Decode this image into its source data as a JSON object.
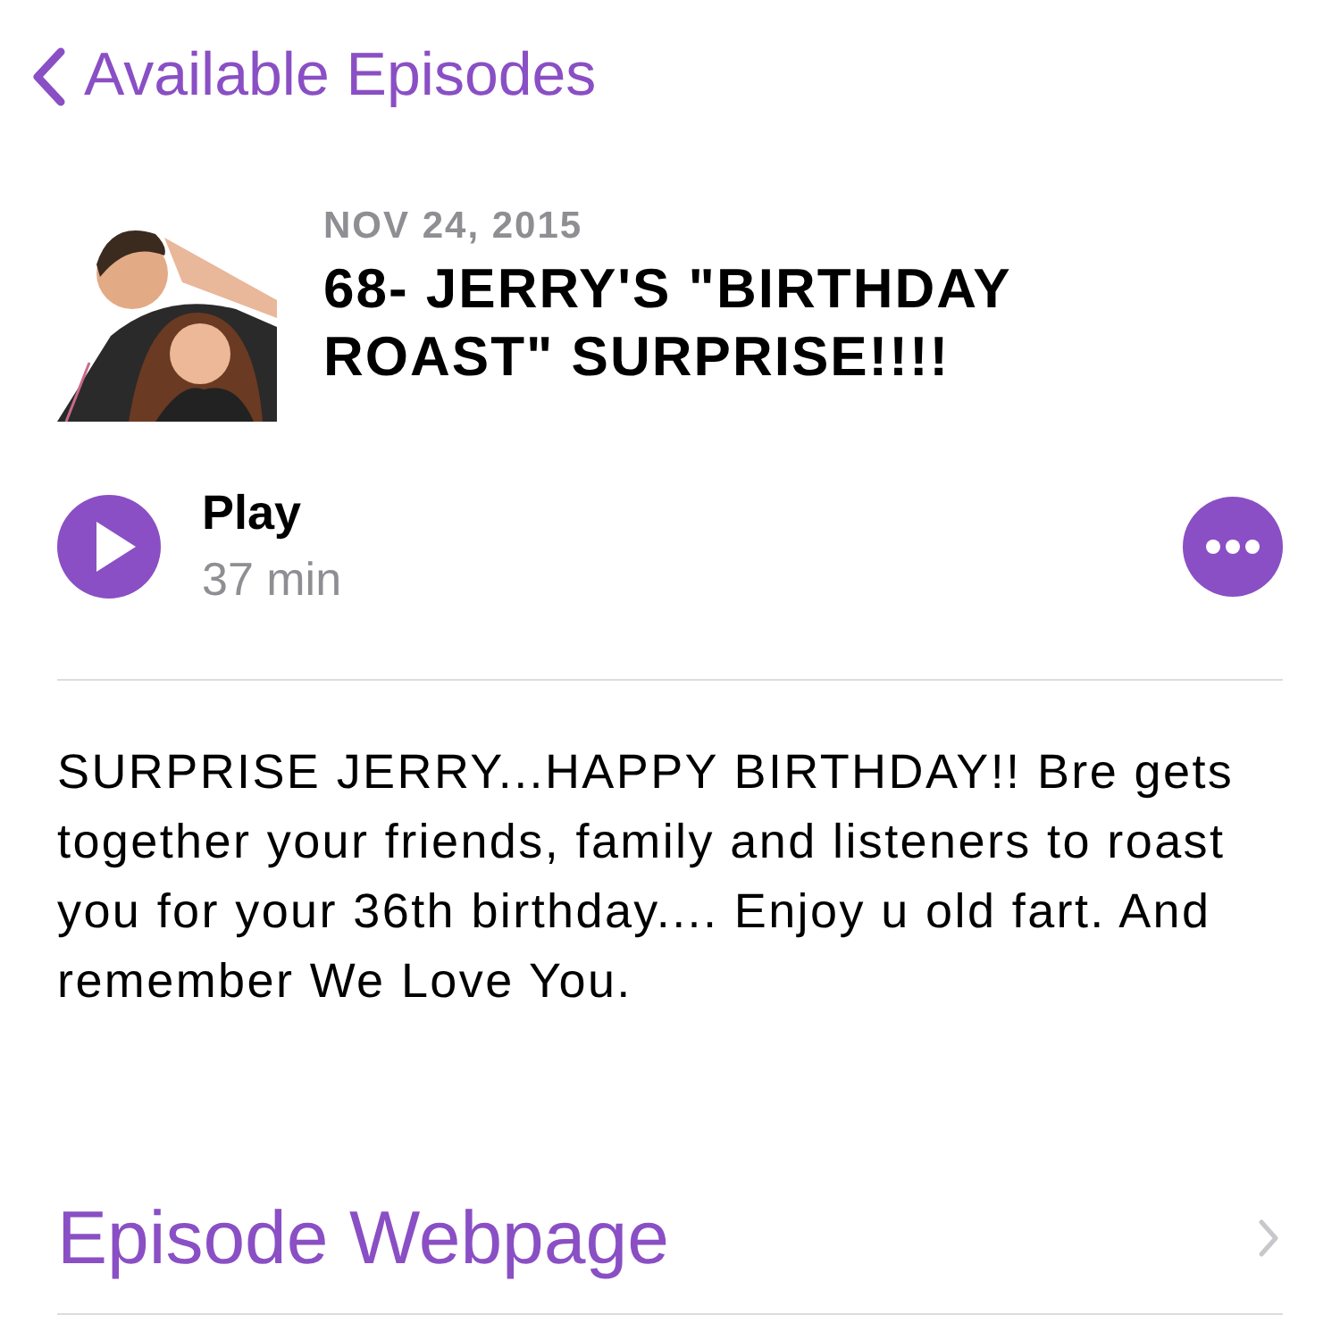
{
  "nav": {
    "back_label": "Available Episodes"
  },
  "episode": {
    "date": "NOV 24, 2015",
    "title": "68- JERRY'S \"BIRTHDAY ROAST\" SURPRISE!!!!"
  },
  "player": {
    "action": "Play",
    "duration": "37 min"
  },
  "description": "SURPRISE JERRY...HAPPY BIRTHDAY!! Bre gets together your friends, family and listeners to roast you for your 36th birthday.... Enjoy u old fart. And remember We Love You.",
  "links": [
    {
      "label": "Episode Webpage"
    }
  ]
}
